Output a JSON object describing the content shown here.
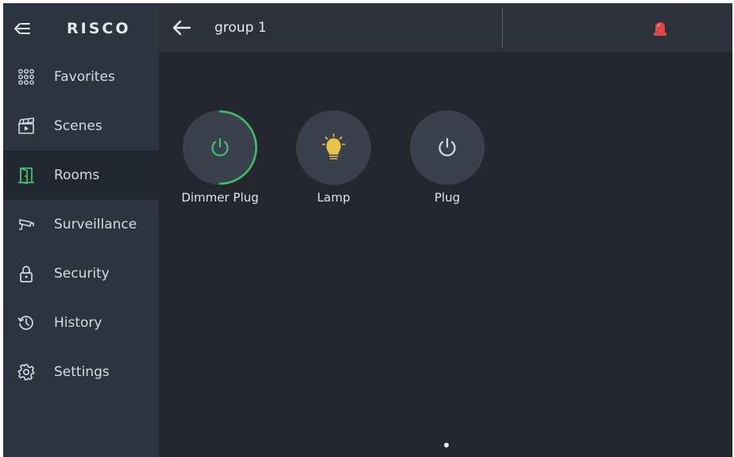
{
  "brand": {
    "name": "RISCO"
  },
  "sidebar": {
    "items": [
      {
        "label": "Favorites",
        "icon": "grid-dots-icon",
        "active": false
      },
      {
        "label": "Scenes",
        "icon": "clapperboard-icon",
        "active": false
      },
      {
        "label": "Rooms",
        "icon": "door-icon",
        "active": true
      },
      {
        "label": "Surveillance",
        "icon": "camera-icon",
        "active": false
      },
      {
        "label": "Security",
        "icon": "lock-icon",
        "active": false
      },
      {
        "label": "History",
        "icon": "history-clock-icon",
        "active": false
      },
      {
        "label": "Settings",
        "icon": "gear-icon",
        "active": false
      }
    ]
  },
  "header": {
    "title": "group 1",
    "alarm_icon": "siren-icon"
  },
  "devices": [
    {
      "label": "Dimmer Plug",
      "icon": "power-icon",
      "state": "on",
      "level_fraction": 0.5
    },
    {
      "label": "Lamp",
      "icon": "lightbulb-icon",
      "state": "on"
    },
    {
      "label": "Plug",
      "icon": "power-icon",
      "state": "off"
    }
  ],
  "pagination": {
    "current": 1,
    "total": 1
  },
  "colors": {
    "accent_green": "#3fbf6e",
    "lamp_yellow": "#e8c24a",
    "alarm_red": "#e04848",
    "sidebar_bg": "#2d3440",
    "content_bg": "#25272e"
  }
}
